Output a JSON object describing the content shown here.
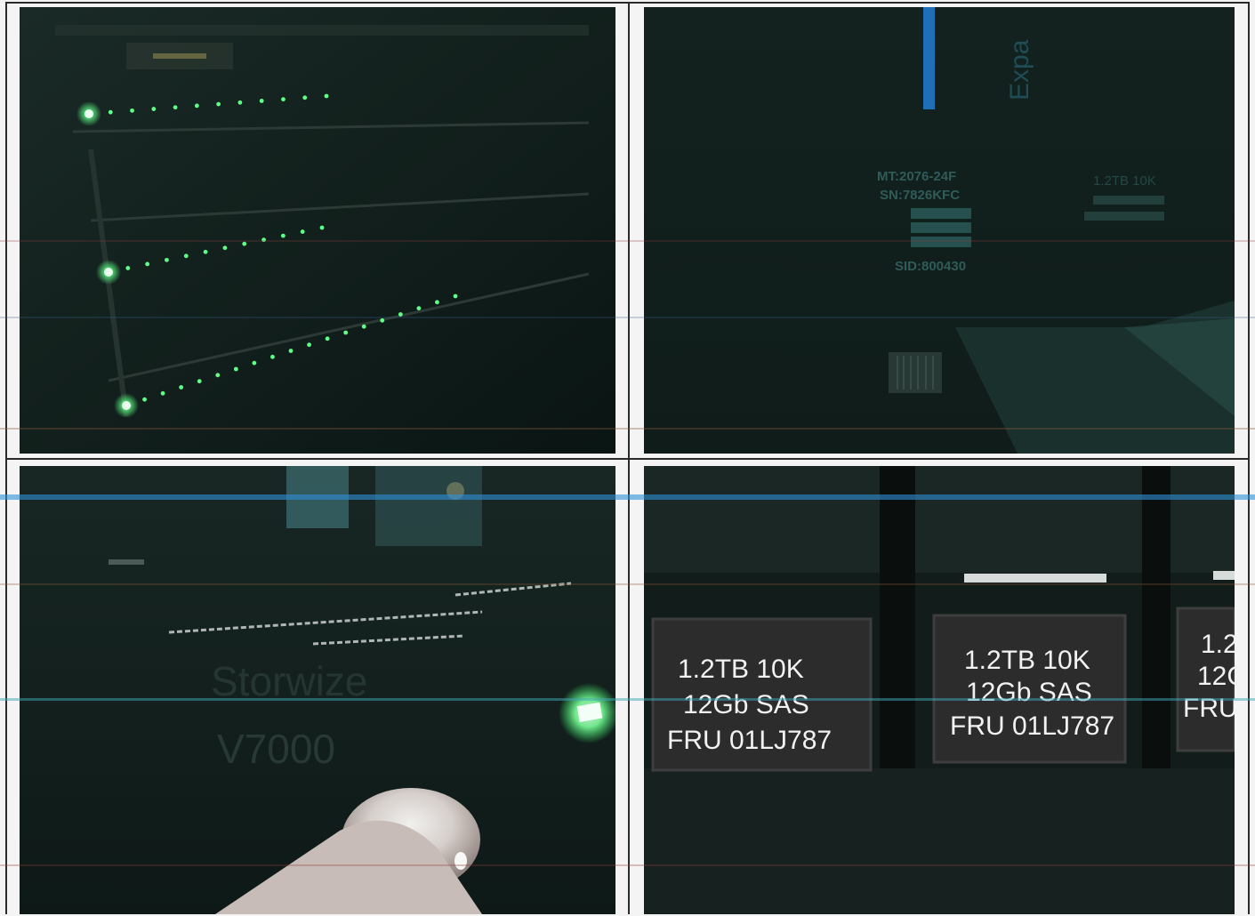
{
  "page": {
    "background": "#f3f4f3",
    "grid_line_color": "#2b2b2b"
  },
  "panels": {
    "top_left": {
      "description_name": "rack-led-photo",
      "led_color": "#5dff86"
    },
    "top_right": {
      "vertical_label": "Expa",
      "label_lines": [
        "MT:2076-24F",
        "SN:7826KFC"
      ],
      "bottom_line": "SID:800430",
      "right_lines": [
        "1.2TB 10K"
      ],
      "accent_color": "#1f6fb8"
    },
    "bottom_left": {
      "brand_line_1": "Storwize",
      "brand_line_2": "V7000",
      "status_led_color": "#7dff9a"
    },
    "bottom_right": {
      "drive_1": {
        "line1": "1.2TB 10K",
        "line2": "12Gb SAS",
        "line3": "FRU 01LJ787"
      },
      "drive_2": {
        "line1": "1.2TB 10K",
        "line2": "12Gb SAS",
        "line3": "FRU 01LJ787"
      },
      "drive_3": {
        "line1": "1.2",
        "line2": "12G",
        "line3": "FRU"
      }
    }
  }
}
